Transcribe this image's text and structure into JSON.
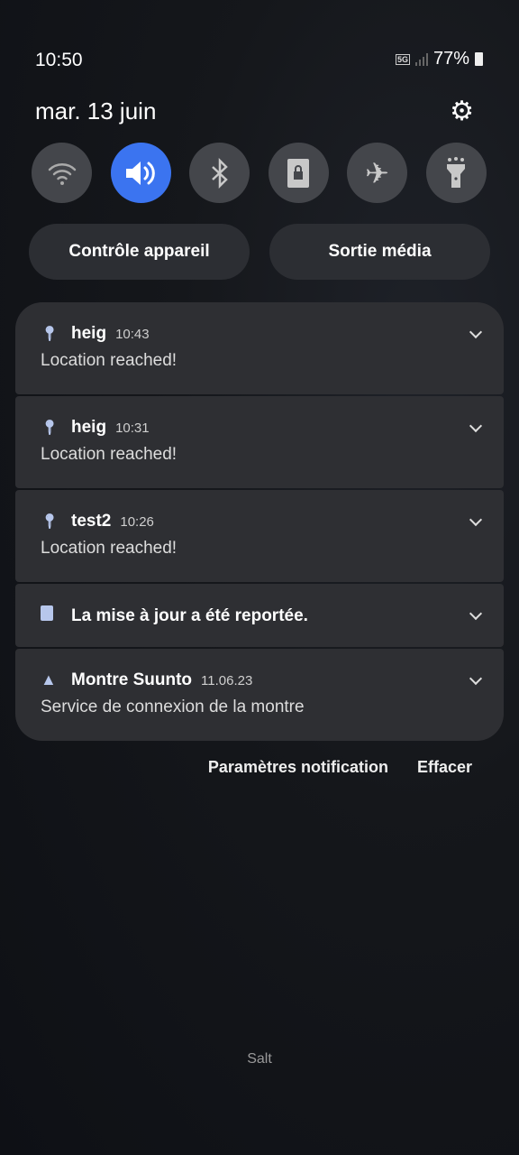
{
  "status_bar": {
    "time": "10:50",
    "network": "5G",
    "battery": "77%"
  },
  "header": {
    "date": "mar. 13 juin"
  },
  "quick_settings": [
    {
      "name": "wifi",
      "active": false
    },
    {
      "name": "sound",
      "active": true
    },
    {
      "name": "bluetooth",
      "active": false
    },
    {
      "name": "screen-lock-rotation",
      "active": false
    },
    {
      "name": "airplane",
      "active": false
    },
    {
      "name": "flashlight",
      "active": false
    }
  ],
  "buttons": {
    "device_control": "Contrôle appareil",
    "media_output": "Sortie média"
  },
  "notifications": [
    {
      "app": "heig",
      "time": "10:43",
      "text": "Location reached!",
      "icon": "location-pin"
    },
    {
      "app": "heig",
      "time": "10:31",
      "text": "Location reached!",
      "icon": "location-pin"
    },
    {
      "app": "test2",
      "time": "10:26",
      "text": "Location reached!",
      "icon": "location-pin"
    },
    {
      "app": "La mise à jour a été reportée.",
      "icon": "update-clock"
    },
    {
      "app": "Montre Suunto",
      "time": "11.06.23",
      "text": "Service de connexion de la montre",
      "icon": "suunto-triangle"
    }
  ],
  "footer": {
    "settings": "Paramètres notification",
    "clear": "Effacer"
  },
  "carrier": "Salt",
  "colors": {
    "accent": "#3b74f0",
    "card": "#2e2f33"
  }
}
